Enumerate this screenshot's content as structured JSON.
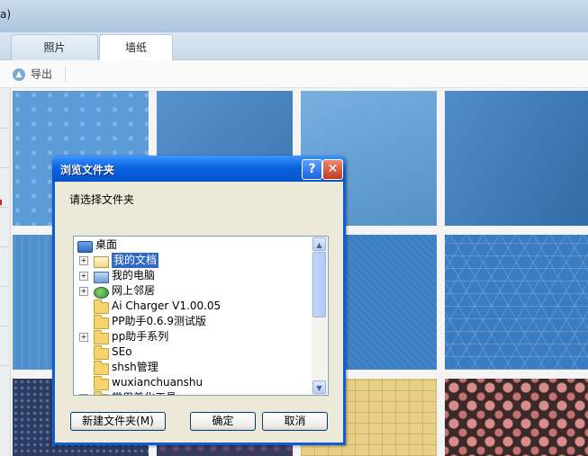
{
  "app": {
    "title_fragment": "a)",
    "tabs": [
      {
        "label": "照片"
      },
      {
        "label": "墙纸"
      }
    ],
    "toolbar": {
      "export_label": "导出"
    }
  },
  "wallpapers": [
    {
      "name": "blue-water-drops",
      "color": "#5b9bd8"
    },
    {
      "name": "blue-wrinkle",
      "color": "#3f84c6"
    },
    {
      "name": "blue-texture-light",
      "color": "#5a9ed8"
    },
    {
      "name": "blue-texture-dark",
      "color": "#3b7fc4"
    },
    {
      "name": "blue-stripes",
      "color": "#4e8fce"
    },
    {
      "name": "blue-plain",
      "color": "#3d7fc2"
    },
    {
      "name": "blue-fabric",
      "color": "#3c7ec4"
    },
    {
      "name": "blue-asanoha-pattern",
      "color": "#3a7cc2"
    },
    {
      "name": "navy-dots",
      "color": "#2c3c60"
    },
    {
      "name": "purple-pattern",
      "color": "#3a3a5e"
    },
    {
      "name": "beige-map",
      "color": "#e8cf86"
    },
    {
      "name": "red-flowers",
      "color": "#3b2a28"
    }
  ],
  "dialog": {
    "title": "浏览文件夹",
    "prompt": "请选择文件夹",
    "tree": [
      {
        "label": "桌面",
        "icon": "desktop-icon",
        "level": 0,
        "expander": null
      },
      {
        "label": "我的文档",
        "icon": "my-documents-icon",
        "level": 1,
        "expander": "+",
        "selected": true
      },
      {
        "label": "我的电脑",
        "icon": "my-computer-icon",
        "level": 1,
        "expander": "+"
      },
      {
        "label": "网上邻居",
        "icon": "network-icon",
        "level": 1,
        "expander": "+"
      },
      {
        "label": "Ai Charger V1.00.05",
        "icon": "folder-icon",
        "level": 1,
        "expander": null
      },
      {
        "label": "PP助手0.6.9测试版",
        "icon": "folder-icon",
        "level": 1,
        "expander": null
      },
      {
        "label": "pp助手系列",
        "icon": "folder-icon",
        "level": 1,
        "expander": "+"
      },
      {
        "label": "SEo",
        "icon": "folder-icon",
        "level": 1,
        "expander": null
      },
      {
        "label": "shsh管理",
        "icon": "folder-icon",
        "level": 1,
        "expander": null
      },
      {
        "label": "wuxianchuanshu",
        "icon": "folder-icon",
        "level": 1,
        "expander": null
      },
      {
        "label": "常用美化工具",
        "icon": "folder-icon",
        "level": 1,
        "expander": "+"
      }
    ],
    "buttons": {
      "new_folder": "新建文件夹(M)",
      "ok": "确定",
      "cancel": "取消"
    },
    "title_buttons": {
      "help": "?",
      "close": "✕"
    }
  }
}
